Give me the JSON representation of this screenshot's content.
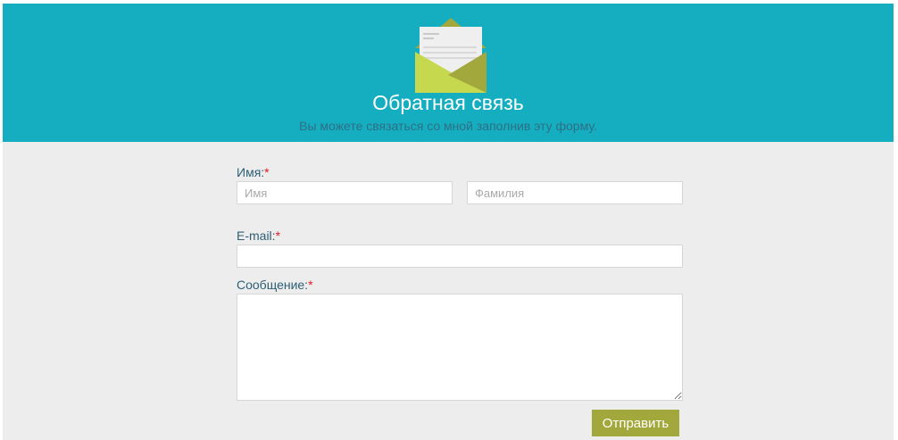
{
  "header": {
    "title": "Обратная связь",
    "subtitle": "Вы можете связаться со мной заполнив эту форму.",
    "icon": "envelope-icon",
    "background_color": "#15aec0"
  },
  "form": {
    "name_label": "Имя:",
    "name_required": "*",
    "first_name_placeholder": "Имя",
    "last_name_placeholder": "Фамилия",
    "email_label": "E-mail:",
    "email_required": "*",
    "message_label": "Сообщение:",
    "message_required": "*",
    "submit_label": "Отправить",
    "submit_color": "#a2a83b",
    "label_color": "#2e5f75",
    "required_color": "#e11b22"
  }
}
